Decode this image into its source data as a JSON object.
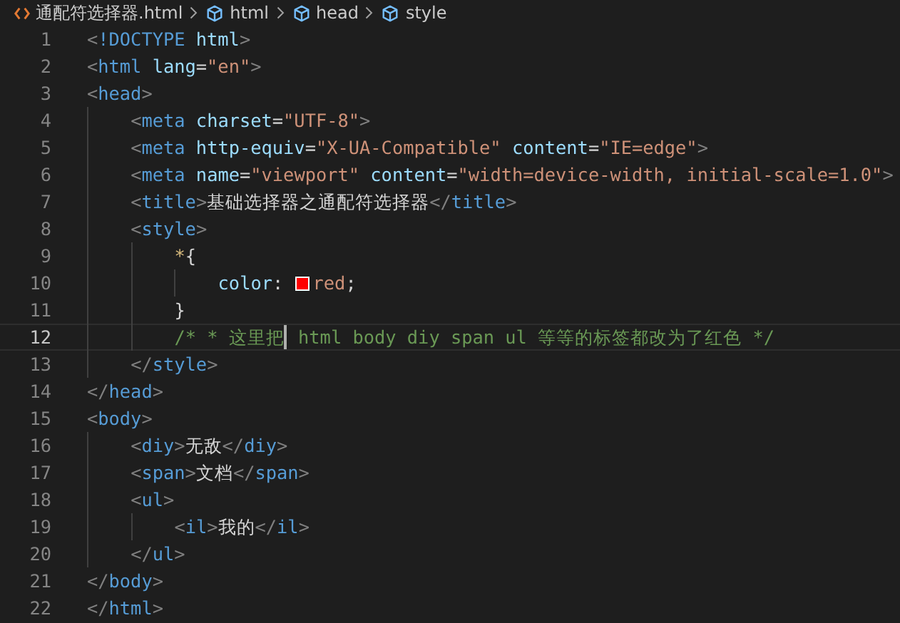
{
  "breadcrumb": [
    {
      "kind": "file",
      "label": "通配符选择器.html"
    },
    {
      "kind": "element",
      "label": "html"
    },
    {
      "kind": "element",
      "label": "head"
    },
    {
      "kind": "element",
      "label": "style"
    }
  ],
  "lines": [
    {
      "number": "1",
      "active": false,
      "tokens": [
        {
          "kind": "punct",
          "text": "<"
        },
        {
          "kind": "tag",
          "text": "!DOCTYPE"
        },
        {
          "kind": "attr",
          "text": " html"
        },
        {
          "kind": "punct",
          "text": ">"
        }
      ]
    },
    {
      "number": "2",
      "active": false,
      "tokens": [
        {
          "kind": "punct",
          "text": "<"
        },
        {
          "kind": "tag",
          "text": "html"
        },
        {
          "kind": "attr",
          "text": " lang"
        },
        {
          "kind": "plain",
          "text": "="
        },
        {
          "kind": "string",
          "text": "\"en\""
        },
        {
          "kind": "punct",
          "text": ">"
        }
      ]
    },
    {
      "number": "3",
      "active": false,
      "tokens": [
        {
          "kind": "punct",
          "text": "<"
        },
        {
          "kind": "tag",
          "text": "head"
        },
        {
          "kind": "punct",
          "text": ">"
        }
      ],
      "children": [
        {
          "number": "4",
          "active": false,
          "tokens": [
            {
              "kind": "punct",
              "text": "<"
            },
            {
              "kind": "tag",
              "text": "meta"
            },
            {
              "kind": "attr",
              "text": " charset"
            },
            {
              "kind": "plain",
              "text": "="
            },
            {
              "kind": "string",
              "text": "\"UTF-8\""
            },
            {
              "kind": "punct",
              "text": ">"
            }
          ]
        },
        {
          "number": "5",
          "active": false,
          "tokens": [
            {
              "kind": "punct",
              "text": "<"
            },
            {
              "kind": "tag",
              "text": "meta"
            },
            {
              "kind": "attr",
              "text": " http-equiv"
            },
            {
              "kind": "plain",
              "text": "="
            },
            {
              "kind": "string",
              "text": "\"X-UA-Compatible\""
            },
            {
              "kind": "attr",
              "text": " content"
            },
            {
              "kind": "plain",
              "text": "="
            },
            {
              "kind": "string",
              "text": "\"IE=edge\""
            },
            {
              "kind": "punct",
              "text": ">"
            }
          ]
        },
        {
          "number": "6",
          "active": false,
          "tokens": [
            {
              "kind": "punct",
              "text": "<"
            },
            {
              "kind": "tag",
              "text": "meta"
            },
            {
              "kind": "attr",
              "text": " name"
            },
            {
              "kind": "plain",
              "text": "="
            },
            {
              "kind": "string",
              "text": "\"viewport\""
            },
            {
              "kind": "attr",
              "text": " content"
            },
            {
              "kind": "plain",
              "text": "="
            },
            {
              "kind": "string",
              "text": "\"width=device-width, initial-scale=1.0\""
            },
            {
              "kind": "punct",
              "text": ">"
            }
          ]
        },
        {
          "number": "7",
          "active": false,
          "tokens": [
            {
              "kind": "punct",
              "text": "<"
            },
            {
              "kind": "tag",
              "text": "title"
            },
            {
              "kind": "punct",
              "text": ">"
            },
            {
              "kind": "plain",
              "text": "基础选择器之通配符选择器"
            },
            {
              "kind": "punct",
              "text": "</"
            },
            {
              "kind": "tag",
              "text": "title"
            },
            {
              "kind": "punct",
              "text": ">"
            }
          ]
        },
        {
          "number": "8",
          "active": false,
          "tokens": [
            {
              "kind": "punct",
              "text": "<"
            },
            {
              "kind": "tag",
              "text": "style"
            },
            {
              "kind": "punct",
              "text": ">"
            }
          ],
          "children": [
            {
              "number": "9",
              "active": false,
              "tokens": [
                {
                  "kind": "selector",
                  "text": "*"
                },
                {
                  "kind": "plain",
                  "text": "{"
                }
              ],
              "children": [
                {
                  "number": "10",
                  "active": false,
                  "tokens": [
                    {
                      "kind": "attr",
                      "text": "color"
                    },
                    {
                      "kind": "plain",
                      "text": ": "
                    },
                    {
                      "kind": "swatch",
                      "color": "#ff0000"
                    },
                    {
                      "kind": "string",
                      "text": "red"
                    },
                    {
                      "kind": "plain",
                      "text": ";"
                    }
                  ]
                }
              ]
            },
            {
              "number": "11",
              "active": false,
              "tokens": [
                {
                  "kind": "plain",
                  "text": "}"
                }
              ]
            },
            {
              "number": "12",
              "active": true,
              "tokens": [
                {
                  "kind": "comment",
                  "text": "/* * 这里把"
                },
                {
                  "kind": "cursor"
                },
                {
                  "kind": "comment",
                  "text": " html body diy span ul 等等的标签都改为了红色 */"
                }
              ]
            }
          ]
        },
        {
          "number": "13",
          "active": false,
          "tokens": [
            {
              "kind": "punct",
              "text": "</"
            },
            {
              "kind": "tag",
              "text": "style"
            },
            {
              "kind": "punct",
              "text": ">"
            }
          ]
        }
      ]
    },
    {
      "number": "14",
      "active": false,
      "tokens": [
        {
          "kind": "punct",
          "text": "</"
        },
        {
          "kind": "tag",
          "text": "head"
        },
        {
          "kind": "punct",
          "text": ">"
        }
      ]
    },
    {
      "number": "15",
      "active": false,
      "tokens": [
        {
          "kind": "punct",
          "text": "<"
        },
        {
          "kind": "tag",
          "text": "body"
        },
        {
          "kind": "punct",
          "text": ">"
        }
      ],
      "children": [
        {
          "number": "16",
          "active": false,
          "tokens": [
            {
              "kind": "punct",
              "text": "<"
            },
            {
              "kind": "tag",
              "text": "diy"
            },
            {
              "kind": "punct",
              "text": ">"
            },
            {
              "kind": "plain",
              "text": "无敌"
            },
            {
              "kind": "punct",
              "text": "</"
            },
            {
              "kind": "tag",
              "text": "diy"
            },
            {
              "kind": "punct",
              "text": ">"
            }
          ]
        },
        {
          "number": "17",
          "active": false,
          "tokens": [
            {
              "kind": "punct",
              "text": "<"
            },
            {
              "kind": "tag",
              "text": "span"
            },
            {
              "kind": "punct",
              "text": ">"
            },
            {
              "kind": "plain",
              "text": "文档"
            },
            {
              "kind": "punct",
              "text": "</"
            },
            {
              "kind": "tag",
              "text": "span"
            },
            {
              "kind": "punct",
              "text": ">"
            }
          ]
        },
        {
          "number": "18",
          "active": false,
          "tokens": [
            {
              "kind": "punct",
              "text": "<"
            },
            {
              "kind": "tag",
              "text": "ul"
            },
            {
              "kind": "punct",
              "text": ">"
            }
          ],
          "children": [
            {
              "number": "19",
              "active": false,
              "tokens": [
                {
                  "kind": "punct",
                  "text": "<"
                },
                {
                  "kind": "tag",
                  "text": "il"
                },
                {
                  "kind": "punct",
                  "text": ">"
                },
                {
                  "kind": "plain",
                  "text": "我的"
                },
                {
                  "kind": "punct",
                  "text": "</"
                },
                {
                  "kind": "tag",
                  "text": "il"
                },
                {
                  "kind": "punct",
                  "text": ">"
                }
              ]
            }
          ]
        },
        {
          "number": "20",
          "active": false,
          "tokens": [
            {
              "kind": "punct",
              "text": "</"
            },
            {
              "kind": "tag",
              "text": "ul"
            },
            {
              "kind": "punct",
              "text": ">"
            }
          ]
        }
      ]
    },
    {
      "number": "21",
      "active": false,
      "tokens": [
        {
          "kind": "punct",
          "text": "</"
        },
        {
          "kind": "tag",
          "text": "body"
        },
        {
          "kind": "punct",
          "text": ">"
        }
      ]
    },
    {
      "number": "22",
      "active": false,
      "tokens": [
        {
          "kind": "punct",
          "text": "</"
        },
        {
          "kind": "tag",
          "text": "html"
        },
        {
          "kind": "punct",
          "text": ">"
        }
      ]
    }
  ]
}
